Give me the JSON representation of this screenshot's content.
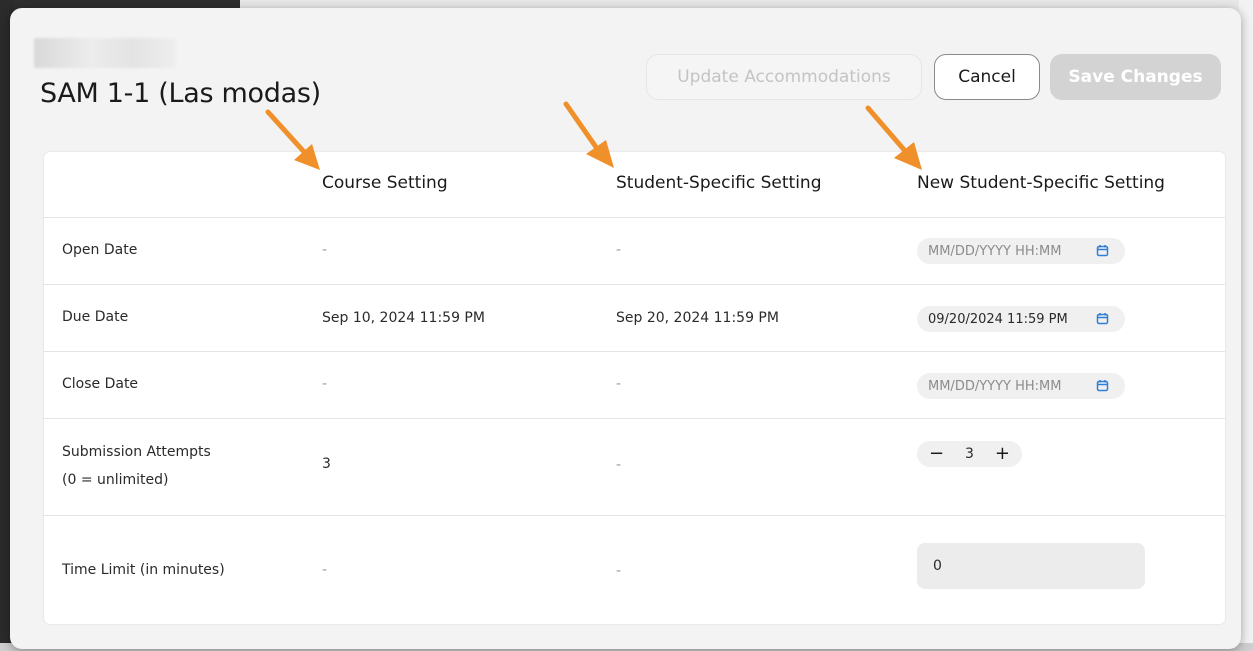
{
  "modal": {
    "title": "SAM 1-1 (Las modas)",
    "buttons": {
      "update": "Update Accommodations",
      "cancel": "Cancel",
      "save": "Save Changes"
    }
  },
  "columns": {
    "course": "Course Setting",
    "student": "Student-Specific Setting",
    "new_student": "New Student-Specific Setting"
  },
  "rows": {
    "open_date": {
      "label": "Open Date",
      "course": "-",
      "student": "-",
      "new_placeholder": "MM/DD/YYYY HH:MM"
    },
    "due_date": {
      "label": "Due Date",
      "course": "Sep 10, 2024 11:59 PM",
      "student": "Sep 20, 2024 11:59 PM",
      "new_value": "09/20/2024 11:59 PM"
    },
    "close_date": {
      "label": "Close Date",
      "course": "-",
      "student": "-",
      "new_placeholder": "MM/DD/YYYY HH:MM"
    },
    "attempts": {
      "label_line1": "Submission Attempts",
      "label_line2": "(0 = unlimited)",
      "course": "3",
      "student": "-",
      "stepper_minus": "−",
      "stepper_value": "3",
      "stepper_plus": "+"
    },
    "time_limit": {
      "label": "Time Limit (in minutes)",
      "course": "-",
      "student": "-",
      "new_value": "0"
    }
  },
  "colors": {
    "arrow": "#f0902a",
    "calendar_icon": "#2f7fd6",
    "save_disabled": "#d3d3d3"
  },
  "icons": [
    "calendar-icon",
    "arrow-annotation"
  ]
}
